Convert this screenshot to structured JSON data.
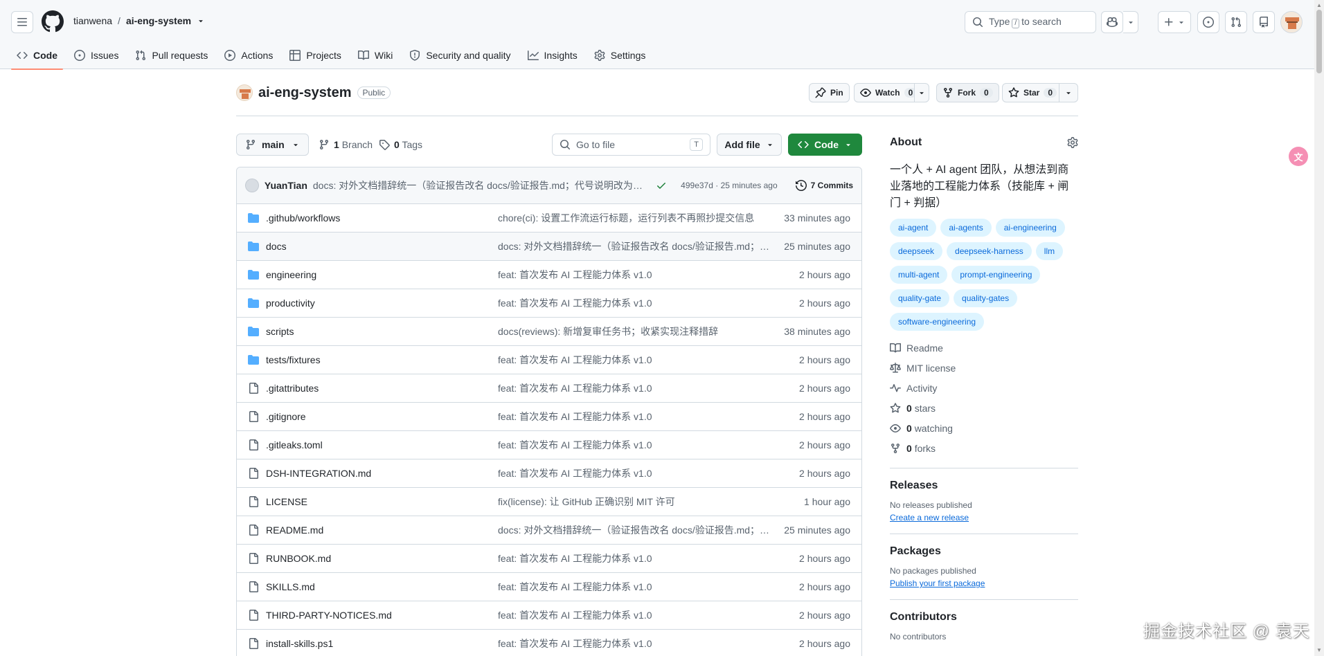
{
  "header": {
    "owner": "tianwena",
    "separator": "/",
    "repo": "ai-eng-system",
    "search_prefix": "Type",
    "search_key": "/",
    "search_suffix": "to search"
  },
  "tabs": [
    {
      "label": "Code",
      "icon": "code-icon",
      "active": true
    },
    {
      "label": "Issues",
      "icon": "issue-icon"
    },
    {
      "label": "Pull requests",
      "icon": "pull-request-icon"
    },
    {
      "label": "Actions",
      "icon": "play-icon"
    },
    {
      "label": "Projects",
      "icon": "table-icon"
    },
    {
      "label": "Wiki",
      "icon": "book-icon"
    },
    {
      "label": "Security and quality",
      "icon": "shield-icon"
    },
    {
      "label": "Insights",
      "icon": "graph-icon"
    },
    {
      "label": "Settings",
      "icon": "gear-icon"
    }
  ],
  "repo_header": {
    "name": "ai-eng-system",
    "visibility": "Public",
    "pin_label": "Pin",
    "watch_label": "Watch",
    "watch_count": "0",
    "fork_label": "Fork",
    "fork_count": "0",
    "star_label": "Star",
    "star_count": "0"
  },
  "toolbar": {
    "branch": "main",
    "branch_count": "1",
    "branch_label": "Branch",
    "tag_count": "0",
    "tag_label": "Tags",
    "go_to_file_placeholder": "Go to file",
    "go_to_file_key": "T",
    "add_file_label": "Add file",
    "code_label": "Code"
  },
  "latest_commit": {
    "author": "YuanTian",
    "message": "docs: 对外文档措辞统一（验证报告改名 docs/验证报告.md；代号说明改为中…",
    "sha": "499e37d",
    "separator": "·",
    "time": "25 minutes ago",
    "commits_label": "7 Commits"
  },
  "files": [
    {
      "type": "folder",
      "name": ".github/workflows",
      "message": "chore(ci): 设置工作流运行标题，运行列表不再照抄提交信息",
      "time": "33 minutes ago"
    },
    {
      "type": "folder",
      "name": "docs",
      "message": "docs: 对外文档措辞统一（验证报告改名 docs/验证报告.md；…",
      "time": "25 minutes ago"
    },
    {
      "type": "folder",
      "name": "engineering",
      "message": "feat: 首次发布 AI 工程能力体系 v1.0",
      "time": "2 hours ago"
    },
    {
      "type": "folder",
      "name": "productivity",
      "message": "feat: 首次发布 AI 工程能力体系 v1.0",
      "time": "2 hours ago"
    },
    {
      "type": "folder",
      "name": "scripts",
      "message": "docs(reviews): 新增复审任务书；收紧实现注释措辞",
      "time": "38 minutes ago"
    },
    {
      "type": "folder",
      "name": "tests/fixtures",
      "message": "feat: 首次发布 AI 工程能力体系 v1.0",
      "time": "2 hours ago"
    },
    {
      "type": "file",
      "name": ".gitattributes",
      "message": "feat: 首次发布 AI 工程能力体系 v1.0",
      "time": "2 hours ago"
    },
    {
      "type": "file",
      "name": ".gitignore",
      "message": "feat: 首次发布 AI 工程能力体系 v1.0",
      "time": "2 hours ago"
    },
    {
      "type": "file",
      "name": ".gitleaks.toml",
      "message": "feat: 首次发布 AI 工程能力体系 v1.0",
      "time": "2 hours ago"
    },
    {
      "type": "file",
      "name": "DSH-INTEGRATION.md",
      "message": "feat: 首次发布 AI 工程能力体系 v1.0",
      "time": "2 hours ago"
    },
    {
      "type": "file",
      "name": "LICENSE",
      "message": "fix(license): 让 GitHub 正确识别 MIT 许可",
      "time": "1 hour ago"
    },
    {
      "type": "file",
      "name": "README.md",
      "message": "docs: 对外文档措辞统一（验证报告改名 docs/验证报告.md；…",
      "time": "25 minutes ago"
    },
    {
      "type": "file",
      "name": "RUNBOOK.md",
      "message": "feat: 首次发布 AI 工程能力体系 v1.0",
      "time": "2 hours ago"
    },
    {
      "type": "file",
      "name": "SKILLS.md",
      "message": "feat: 首次发布 AI 工程能力体系 v1.0",
      "time": "2 hours ago"
    },
    {
      "type": "file",
      "name": "THIRD-PARTY-NOTICES.md",
      "message": "feat: 首次发布 AI 工程能力体系 v1.0",
      "time": "2 hours ago"
    },
    {
      "type": "file",
      "name": "install-skills.ps1",
      "message": "feat: 首次发布 AI 工程能力体系 v1.0",
      "time": "2 hours ago"
    }
  ],
  "about": {
    "title": "About",
    "description": "一个人 + AI agent 团队，从想法到商业落地的工程能力体系（技能库 + 闸门 + 判据）",
    "topics": [
      "ai-agent",
      "ai-agents",
      "ai-engineering",
      "deepseek",
      "deepseek-harness",
      "llm",
      "multi-agent",
      "prompt-engineering",
      "quality-gate",
      "quality-gates",
      "software-engineering"
    ],
    "links": [
      {
        "icon": "book-icon",
        "label": "Readme",
        "count": ""
      },
      {
        "icon": "law-icon",
        "label": "MIT license",
        "count": ""
      },
      {
        "icon": "pulse-icon",
        "label": "Activity",
        "count": ""
      },
      {
        "icon": "star-icon",
        "label": "stars",
        "count": "0"
      },
      {
        "icon": "eye-icon",
        "label": "watching",
        "count": "0"
      },
      {
        "icon": "fork-icon",
        "label": "forks",
        "count": "0"
      }
    ]
  },
  "releases": {
    "title": "Releases",
    "empty": "No releases published",
    "link": "Create a new release"
  },
  "packages": {
    "title": "Packages",
    "empty": "No packages published",
    "link": "Publish your first package"
  },
  "contributors": {
    "title": "Contributors",
    "empty": "No contributors"
  },
  "overlay": {
    "translate_glyph": "文",
    "watermark": "掘金技术社区 @ 袁天"
  },
  "colors": {
    "accent_tab": "#fd8c73",
    "code_button": "#1f883d",
    "topic_bg": "#ddf4ff",
    "topic_text": "#0969da",
    "folder": "#54aeff"
  }
}
